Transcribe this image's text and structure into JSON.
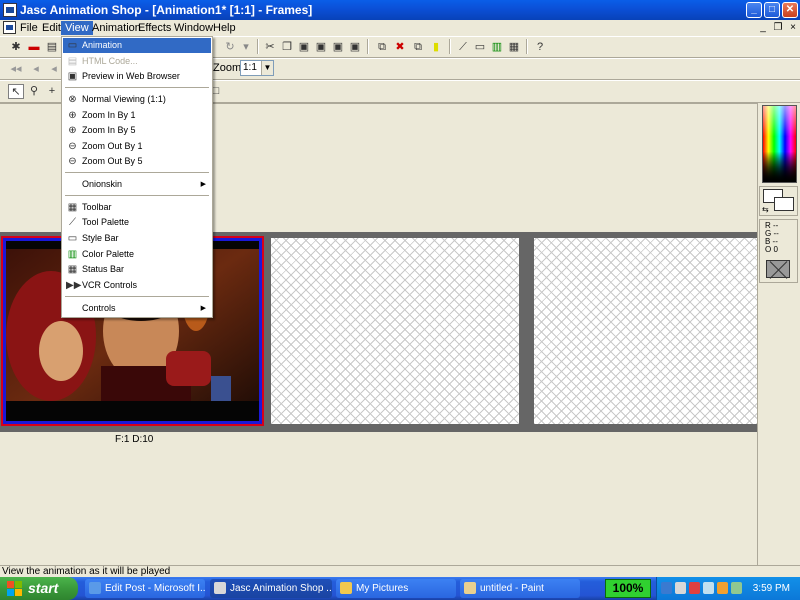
{
  "window": {
    "title": "Jasc Animation Shop - [Animation1* [1:1] - Frames]",
    "buttons": {
      "minimize": "_",
      "maximize": "□",
      "close": "✕"
    }
  },
  "menubar": {
    "items": [
      {
        "label": "File"
      },
      {
        "label": "Edit"
      },
      {
        "label": "View"
      },
      {
        "label": "Animation"
      },
      {
        "label": "Effects"
      },
      {
        "label": "Window"
      },
      {
        "label": "Help"
      }
    ],
    "doc_controls": {
      "minimize": "_",
      "restore": "❐",
      "close": "×"
    }
  },
  "toolbar": {
    "zoom_label": "Zoom:",
    "zoom_value": "1:1"
  },
  "view_menu": {
    "items": [
      {
        "label": "Animation",
        "icon": "animation-icon"
      },
      {
        "label": "HTML Code...",
        "icon": "html-code-icon"
      },
      {
        "label": "Preview in Web Browser",
        "icon": "preview-browser-icon"
      },
      {
        "label": "Normal Viewing (1:1)",
        "icon": "normal-view-icon"
      },
      {
        "label": "Zoom In By 1",
        "icon": "zoom-in-icon"
      },
      {
        "label": "Zoom In By 5",
        "icon": "zoom-in-icon"
      },
      {
        "label": "Zoom Out By 1",
        "icon": "zoom-out-icon"
      },
      {
        "label": "Zoom Out By 5",
        "icon": "zoom-out-icon"
      },
      {
        "label": "Onionskin",
        "icon": ""
      },
      {
        "label": "Toolbar",
        "icon": "toolbar-icon"
      },
      {
        "label": "Tool Palette",
        "icon": "tool-palette-icon"
      },
      {
        "label": "Style Bar",
        "icon": "style-bar-icon"
      },
      {
        "label": "Color Palette",
        "icon": "color-palette-icon"
      },
      {
        "label": "Status Bar",
        "icon": "status-bar-icon"
      },
      {
        "label": "VCR Controls",
        "icon": "vcr-controls-icon"
      },
      {
        "label": "Controls",
        "icon": ""
      }
    ],
    "submenu_arrow": "▶"
  },
  "frames": {
    "frame1_info": "F:1   D:10"
  },
  "color_info": {
    "r": "R --",
    "g": "G --",
    "b": "B --",
    "o": "O 0"
  },
  "statusbar": {
    "text": "View the animation as it will be played"
  },
  "taskbar": {
    "start_label": "start",
    "tasks": [
      {
        "label": "Edit Post - Microsoft I..."
      },
      {
        "label": "Jasc Animation Shop ..."
      },
      {
        "label": "My Pictures"
      },
      {
        "label": "untitled - Paint"
      }
    ],
    "gauge": "100%",
    "clock": "3:59 PM"
  },
  "colors": {
    "selection": "#316ac5",
    "title_blue": "#0b4fd6",
    "frame_border_blue": "#1b18d8",
    "frame_border_red": "#d8001a",
    "taskbar_blue": "#245edb",
    "start_green": "#3a9a3a"
  }
}
